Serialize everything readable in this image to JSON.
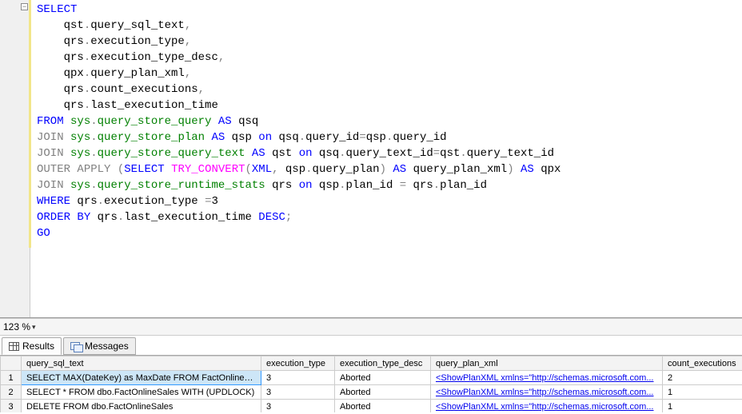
{
  "editor": {
    "zoom_label": "123 %",
    "code_lines": [
      [
        {
          "t": "SELECT",
          "c": "kw-blue"
        }
      ],
      [
        {
          "t": "    qst",
          "c": "tok-default"
        },
        {
          "t": ".",
          "c": "kw-gray"
        },
        {
          "t": "query_sql_text",
          "c": "tok-default"
        },
        {
          "t": ",",
          "c": "kw-gray"
        }
      ],
      [
        {
          "t": "    qrs",
          "c": "tok-default"
        },
        {
          "t": ".",
          "c": "kw-gray"
        },
        {
          "t": "execution_type",
          "c": "tok-default"
        },
        {
          "t": ",",
          "c": "kw-gray"
        }
      ],
      [
        {
          "t": "    qrs",
          "c": "tok-default"
        },
        {
          "t": ".",
          "c": "kw-gray"
        },
        {
          "t": "execution_type_desc",
          "c": "tok-default"
        },
        {
          "t": ",",
          "c": "kw-gray"
        }
      ],
      [
        {
          "t": "    qpx",
          "c": "tok-default"
        },
        {
          "t": ".",
          "c": "kw-gray"
        },
        {
          "t": "query_plan_xml",
          "c": "tok-default"
        },
        {
          "t": ",",
          "c": "kw-gray"
        }
      ],
      [
        {
          "t": "    qrs",
          "c": "tok-default"
        },
        {
          "t": ".",
          "c": "kw-gray"
        },
        {
          "t": "count_executions",
          "c": "tok-default"
        },
        {
          "t": ",",
          "c": "kw-gray"
        }
      ],
      [
        {
          "t": "    qrs",
          "c": "tok-default"
        },
        {
          "t": ".",
          "c": "kw-gray"
        },
        {
          "t": "last_execution_time",
          "c": "tok-default"
        }
      ],
      [
        {
          "t": "FROM",
          "c": "kw-blue"
        },
        {
          "t": " ",
          "c": "tok-default"
        },
        {
          "t": "sys",
          "c": "kw-green"
        },
        {
          "t": ".",
          "c": "kw-gray"
        },
        {
          "t": "query_store_query",
          "c": "kw-green"
        },
        {
          "t": " ",
          "c": "tok-default"
        },
        {
          "t": "AS",
          "c": "kw-blue"
        },
        {
          "t": " qsq",
          "c": "tok-default"
        }
      ],
      [
        {
          "t": "JOIN",
          "c": "kw-gray"
        },
        {
          "t": " ",
          "c": "tok-default"
        },
        {
          "t": "sys",
          "c": "kw-green"
        },
        {
          "t": ".",
          "c": "kw-gray"
        },
        {
          "t": "query_store_plan",
          "c": "kw-green"
        },
        {
          "t": " ",
          "c": "tok-default"
        },
        {
          "t": "AS",
          "c": "kw-blue"
        },
        {
          "t": " qsp ",
          "c": "tok-default"
        },
        {
          "t": "on",
          "c": "kw-blue"
        },
        {
          "t": " qsq",
          "c": "tok-default"
        },
        {
          "t": ".",
          "c": "kw-gray"
        },
        {
          "t": "query_id",
          "c": "tok-default"
        },
        {
          "t": "=",
          "c": "kw-gray"
        },
        {
          "t": "qsp",
          "c": "tok-default"
        },
        {
          "t": ".",
          "c": "kw-gray"
        },
        {
          "t": "query_id",
          "c": "tok-default"
        }
      ],
      [
        {
          "t": "JOIN",
          "c": "kw-gray"
        },
        {
          "t": " ",
          "c": "tok-default"
        },
        {
          "t": "sys",
          "c": "kw-green"
        },
        {
          "t": ".",
          "c": "kw-gray"
        },
        {
          "t": "query_store_query_text",
          "c": "kw-green"
        },
        {
          "t": " ",
          "c": "tok-default"
        },
        {
          "t": "AS",
          "c": "kw-blue"
        },
        {
          "t": " qst ",
          "c": "tok-default"
        },
        {
          "t": "on",
          "c": "kw-blue"
        },
        {
          "t": " qsq",
          "c": "tok-default"
        },
        {
          "t": ".",
          "c": "kw-gray"
        },
        {
          "t": "query_text_id",
          "c": "tok-default"
        },
        {
          "t": "=",
          "c": "kw-gray"
        },
        {
          "t": "qst",
          "c": "tok-default"
        },
        {
          "t": ".",
          "c": "kw-gray"
        },
        {
          "t": "query_text_id",
          "c": "tok-default"
        }
      ],
      [
        {
          "t": "OUTER",
          "c": "kw-gray"
        },
        {
          "t": " ",
          "c": "tok-default"
        },
        {
          "t": "APPLY",
          "c": "kw-gray"
        },
        {
          "t": " ",
          "c": "tok-default"
        },
        {
          "t": "(",
          "c": "kw-gray"
        },
        {
          "t": "SELECT",
          "c": "kw-blue"
        },
        {
          "t": " ",
          "c": "tok-default"
        },
        {
          "t": "TRY_CONVERT",
          "c": "kw-pink"
        },
        {
          "t": "(",
          "c": "kw-gray"
        },
        {
          "t": "XML",
          "c": "kw-blue"
        },
        {
          "t": ",",
          "c": "kw-gray"
        },
        {
          "t": " qsp",
          "c": "tok-default"
        },
        {
          "t": ".",
          "c": "kw-gray"
        },
        {
          "t": "query_plan",
          "c": "tok-default"
        },
        {
          "t": ")",
          "c": "kw-gray"
        },
        {
          "t": " ",
          "c": "tok-default"
        },
        {
          "t": "AS",
          "c": "kw-blue"
        },
        {
          "t": " query_plan_xml",
          "c": "tok-default"
        },
        {
          "t": ")",
          "c": "kw-gray"
        },
        {
          "t": " ",
          "c": "tok-default"
        },
        {
          "t": "AS",
          "c": "kw-blue"
        },
        {
          "t": " qpx",
          "c": "tok-default"
        }
      ],
      [
        {
          "t": "JOIN",
          "c": "kw-gray"
        },
        {
          "t": " ",
          "c": "tok-default"
        },
        {
          "t": "sys",
          "c": "kw-green"
        },
        {
          "t": ".",
          "c": "kw-gray"
        },
        {
          "t": "query_store_runtime_stats",
          "c": "kw-green"
        },
        {
          "t": " qrs ",
          "c": "tok-default"
        },
        {
          "t": "on",
          "c": "kw-blue"
        },
        {
          "t": " qsp",
          "c": "tok-default"
        },
        {
          "t": ".",
          "c": "kw-gray"
        },
        {
          "t": "plan_id",
          "c": "tok-default"
        },
        {
          "t": " ",
          "c": "tok-default"
        },
        {
          "t": "=",
          "c": "kw-gray"
        },
        {
          "t": " qrs",
          "c": "tok-default"
        },
        {
          "t": ".",
          "c": "kw-gray"
        },
        {
          "t": "plan_id",
          "c": "tok-default"
        }
      ],
      [
        {
          "t": "WHERE",
          "c": "kw-blue"
        },
        {
          "t": " qrs",
          "c": "tok-default"
        },
        {
          "t": ".",
          "c": "kw-gray"
        },
        {
          "t": "execution_type",
          "c": "tok-default"
        },
        {
          "t": " ",
          "c": "tok-default"
        },
        {
          "t": "=",
          "c": "kw-gray"
        },
        {
          "t": "3",
          "c": "tok-default"
        }
      ],
      [
        {
          "t": "ORDER",
          "c": "kw-blue"
        },
        {
          "t": " ",
          "c": "tok-default"
        },
        {
          "t": "BY",
          "c": "kw-blue"
        },
        {
          "t": " qrs",
          "c": "tok-default"
        },
        {
          "t": ".",
          "c": "kw-gray"
        },
        {
          "t": "last_execution_time",
          "c": "tok-default"
        },
        {
          "t": " ",
          "c": "tok-default"
        },
        {
          "t": "DESC",
          "c": "kw-blue"
        },
        {
          "t": ";",
          "c": "kw-gray"
        }
      ],
      [
        {
          "t": "GO",
          "c": "kw-blue"
        }
      ]
    ]
  },
  "tabs": {
    "results": "Results",
    "messages": "Messages"
  },
  "grid": {
    "columns": [
      "query_sql_text",
      "execution_type",
      "execution_type_desc",
      "query_plan_xml",
      "count_executions"
    ],
    "row_numbers": [
      "1",
      "2",
      "3"
    ],
    "rows": [
      {
        "query_sql_text": "SELECT MAX(DateKey) as MaxDate  FROM FactOnlineS...",
        "execution_type": "3",
        "execution_type_desc": "Aborted",
        "query_plan_xml": "<ShowPlanXML xmlns=\"http://schemas.microsoft.com...",
        "count_executions": "2"
      },
      {
        "query_sql_text": "SELECT * FROM dbo.FactOnlineSales WITH (UPDLOCK)",
        "execution_type": "3",
        "execution_type_desc": "Aborted",
        "query_plan_xml": "<ShowPlanXML xmlns=\"http://schemas.microsoft.com...",
        "count_executions": "1"
      },
      {
        "query_sql_text": "DELETE FROM dbo.FactOnlineSales",
        "execution_type": "3",
        "execution_type_desc": "Aborted",
        "query_plan_xml": "<ShowPlanXML xmlns=\"http://schemas.microsoft.com...",
        "count_executions": "1"
      }
    ]
  }
}
